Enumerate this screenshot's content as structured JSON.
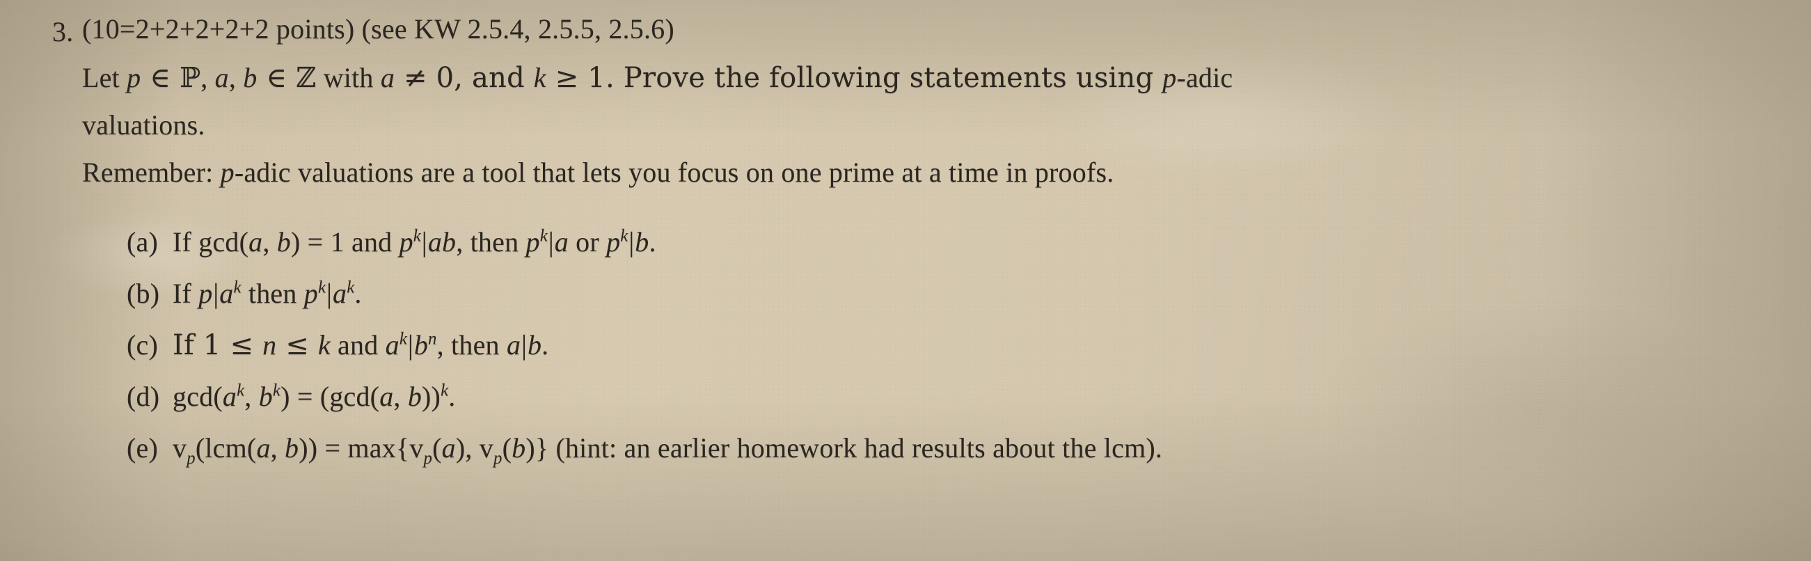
{
  "document": {
    "type": "printed-math-homework-photo",
    "paper_color": "#cfc3ac",
    "ink_color": "#2b2620"
  },
  "problem": {
    "number": "3.",
    "header_line": "(10=2+2+2+2+2 points) (see KW 2.5.4, 2.5.5, 2.5.6)",
    "points_breakdown": "10=2+2+2+2+2 points",
    "reference": "(see KW 2.5.4, 2.5.5, 2.5.6)",
    "body": {
      "line1": {
        "t1": "Let ",
        "p": "p",
        "t2": " ∈ ",
        "P": "ℙ",
        "t3": ", ",
        "a": "a",
        "t4": ", ",
        "b": "b",
        "t5": " ∈ ",
        "Z": "ℤ",
        "t6": " with ",
        "a2": "a",
        "t7": " ≠ 0, and ",
        "k": "k",
        "t8": " ≥ 1. Prove the following statements using ",
        "p2": "p",
        "t9": "-adic"
      },
      "line2": "valuations.",
      "line3": {
        "t1": "Remember: ",
        "p": "p",
        "t2": "-adic valuations are a tool that lets you focus on one prime at a time in proofs."
      }
    },
    "items": [
      {
        "label": "(a)",
        "plain": "If gcd(a, b) = 1 and p^k|ab, then p^k|a or p^k|b.",
        "parts": {
          "t1": "If gcd(",
          "a": "a",
          "t2": ", ",
          "b": "b",
          "t3": ") = 1 and ",
          "p": "p",
          "k": "k",
          "bar1": "|",
          "ab": "ab",
          "t4": ", then ",
          "p2": "p",
          "k2": "k",
          "bar2": "|",
          "a2": "a",
          "t5": " or ",
          "p3": "p",
          "k3": "k",
          "bar3": "|",
          "b2": "b",
          "t6": "."
        }
      },
      {
        "label": "(b)",
        "plain": "If p|a^k then p^k|a^k.",
        "parts": {
          "t1": "If ",
          "p": "p",
          "bar1": "|",
          "a": "a",
          "k1": "k",
          "t2": " then ",
          "p2": "p",
          "k2": "k",
          "bar2": "|",
          "a2": "a",
          "k3": "k",
          "t3": "."
        }
      },
      {
        "label": "(c)",
        "plain": "If 1 ≤ n ≤ k and a^k|b^n, then a|b.",
        "parts": {
          "t1": "If 1 ≤ ",
          "n": "n",
          "t2": " ≤ ",
          "k": "k",
          "t3": " and ",
          "a": "a",
          "k2": "k",
          "bar1": "|",
          "b": "b",
          "n2": "n",
          "t4": ", then ",
          "a2": "a",
          "bar2": "|",
          "b2": "b",
          "t5": "."
        }
      },
      {
        "label": "(d)",
        "plain": "gcd(a^k, b^k) = (gcd(a, b))^k.",
        "parts": {
          "t1": "gcd(",
          "a": "a",
          "k1": "k",
          "t2": ", ",
          "b": "b",
          "k2": "k",
          "t3": ") = (gcd(",
          "a2": "a",
          "t4": ", ",
          "b2": "b",
          "t5": "))",
          "k3": "k",
          "t6": "."
        }
      },
      {
        "label": "(e)",
        "plain": "v_p(lcm(a, b)) = max{v_p(a), v_p(b)} (hint: an earlier homework had results about the lcm).",
        "parts": {
          "v1": "v",
          "p1": "p",
          "t1": "(lcm(",
          "a": "a",
          "t2": ", ",
          "b": "b",
          "t3": ")) = max{",
          "v2": "v",
          "p2": "p",
          "t4": "(",
          "a2": "a",
          "t5": "), ",
          "v3": "v",
          "p3": "p",
          "t6": "(",
          "b2": "b",
          "t7": ")} (hint: an earlier homework had results about the lcm)."
        }
      }
    ]
  }
}
